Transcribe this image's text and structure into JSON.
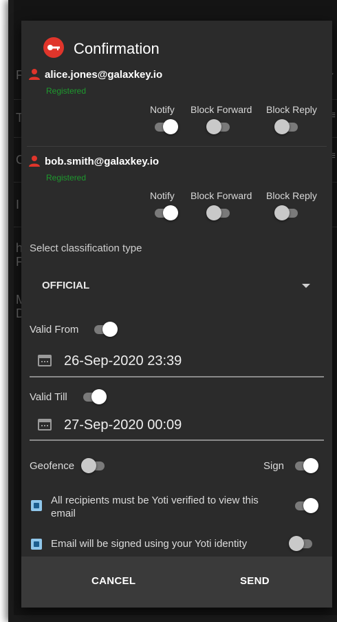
{
  "background": {
    "letters": [
      "F",
      "T",
      "C",
      "I",
      "h",
      "F",
      "M",
      "D"
    ]
  },
  "dialog": {
    "title": "Confirmation",
    "recipients": [
      {
        "email": "alice.jones@galaxkey.io",
        "status": "Registered",
        "notify_label": "Notify",
        "block_forward_label": "Block Forward",
        "block_reply_label": "Block Reply",
        "notify": true,
        "block_forward": false,
        "block_reply": false
      },
      {
        "email": "bob.smith@galaxkey.io",
        "status": "Registered",
        "notify_label": "Notify",
        "block_forward_label": "Block Forward",
        "block_reply_label": "Block Reply",
        "notify": true,
        "block_forward": false,
        "block_reply": false
      }
    ],
    "classification": {
      "label": "Select classification type",
      "value": "OFFICIAL"
    },
    "valid_from": {
      "label": "Valid From",
      "enabled": true,
      "value": "26-Sep-2020 23:39"
    },
    "valid_till": {
      "label": "Valid Till",
      "enabled": true,
      "value": "27-Sep-2020 00:09"
    },
    "geofence": {
      "label": "Geofence",
      "enabled": false
    },
    "sign": {
      "label": "Sign",
      "enabled": true
    },
    "yoti_verified": {
      "label_line1": "All recipients must be Yoti verified to view this",
      "label_line2": "email",
      "enabled": true
    },
    "yoti_sign": {
      "label": "Email will be signed using your Yoti identity",
      "enabled": false
    },
    "cancel_label": "CANCEL",
    "send_label": "SEND"
  },
  "colors": {
    "accent_red": "#e0352b",
    "registered_green": "#1e9a2e",
    "dialog_bg": "#2b2b2b",
    "footer_bg": "#3a3a3a"
  }
}
